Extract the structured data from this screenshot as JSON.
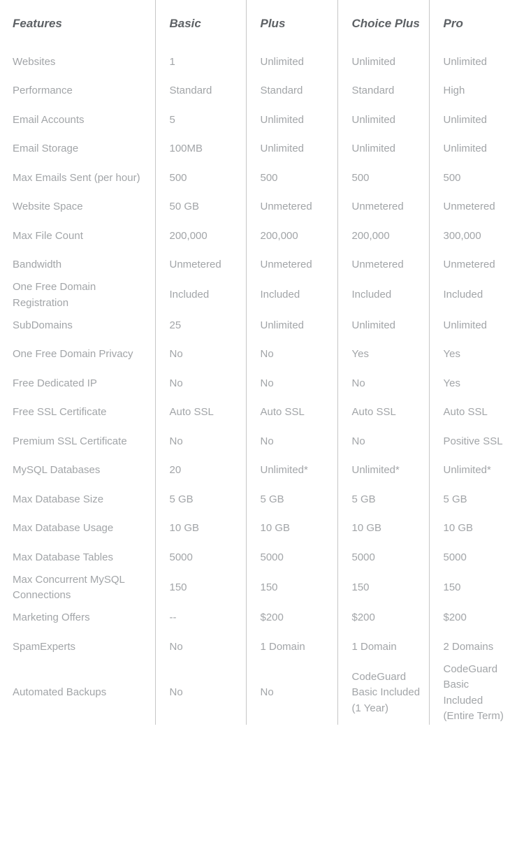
{
  "table": {
    "headers": [
      {
        "label": "Features",
        "key": "features"
      },
      {
        "label": "Basic",
        "key": "basic"
      },
      {
        "label": "Plus",
        "key": "plus"
      },
      {
        "label": "Choice Plus",
        "key": "choice_plus"
      },
      {
        "label": "Pro",
        "key": "pro"
      }
    ],
    "rows": [
      {
        "feature": "Websites",
        "basic": "1",
        "plus": "Unlimited",
        "choice_plus": "Unlimited",
        "pro": "Unlimited"
      },
      {
        "feature": "Performance",
        "basic": "Standard",
        "plus": "Standard",
        "choice_plus": "Standard",
        "pro": "High"
      },
      {
        "feature": "Email Accounts",
        "basic": "5",
        "plus": "Unlimited",
        "choice_plus": "Unlimited",
        "pro": "Unlimited"
      },
      {
        "feature": "Email Storage",
        "basic": "100MB",
        "plus": "Unlimited",
        "choice_plus": "Unlimited",
        "pro": "Unlimited"
      },
      {
        "feature": "Max Emails Sent (per hour)",
        "basic": "500",
        "plus": "500",
        "choice_plus": "500",
        "pro": "500"
      },
      {
        "feature": "Website Space",
        "basic": "50 GB",
        "plus": "Unmetered",
        "choice_plus": "Unmetered",
        "pro": "Unmetered"
      },
      {
        "feature": "Max File Count",
        "basic": "200,000",
        "plus": "200,000",
        "choice_plus": "200,000",
        "pro": "300,000"
      },
      {
        "feature": "Bandwidth",
        "basic": "Unmetered",
        "plus": "Unmetered",
        "choice_plus": "Unmetered",
        "pro": "Unmetered"
      },
      {
        "feature": "One Free Domain Registration",
        "basic": "Included",
        "plus": "Included",
        "choice_plus": "Included",
        "pro": "Included"
      },
      {
        "feature": "SubDomains",
        "basic": "25",
        "plus": "Unlimited",
        "choice_plus": "Unlimited",
        "pro": "Unlimited"
      },
      {
        "feature": "One Free Domain Privacy",
        "basic": "No",
        "plus": "No",
        "choice_plus": "Yes",
        "pro": "Yes"
      },
      {
        "feature": "Free Dedicated IP",
        "basic": "No",
        "plus": "No",
        "choice_plus": "No",
        "pro": "Yes"
      },
      {
        "feature": "Free SSL Certificate",
        "basic": "Auto SSL",
        "plus": "Auto SSL",
        "choice_plus": "Auto SSL",
        "pro": "Auto SSL"
      },
      {
        "feature": "Premium SSL Certificate",
        "basic": "No",
        "plus": "No",
        "choice_plus": "No",
        "pro": "Positive SSL"
      },
      {
        "feature": "MySQL Databases",
        "basic": "20",
        "plus": "Unlimited*",
        "choice_plus": "Unlimited*",
        "pro": "Unlimited*"
      },
      {
        "feature": "Max Database Size",
        "basic": "5 GB",
        "plus": "5 GB",
        "choice_plus": "5 GB",
        "pro": "5 GB"
      },
      {
        "feature": "Max Database Usage",
        "basic": "10 GB",
        "plus": "10 GB",
        "choice_plus": "10 GB",
        "pro": "10 GB"
      },
      {
        "feature": "Max Database Tables",
        "basic": "5000",
        "plus": "5000",
        "choice_plus": "5000",
        "pro": "5000"
      },
      {
        "feature": "Max Concurrent MySQL Connections",
        "basic": "150",
        "plus": "150",
        "choice_plus": "150",
        "pro": "150"
      },
      {
        "feature": "Marketing Offers",
        "basic": "--",
        "plus": "$200",
        "choice_plus": "$200",
        "pro": "$200"
      },
      {
        "feature": "SpamExperts",
        "basic": "No",
        "plus": "1 Domain",
        "choice_plus": "1 Domain",
        "pro": "2 Domains"
      },
      {
        "feature": "Automated Backups",
        "basic": "No",
        "plus": "No",
        "choice_plus": "CodeGuard Basic Included (1 Year)",
        "pro": "CodeGuard Basic Included (Entire Term)"
      }
    ]
  },
  "colors": {
    "header_text": "#5d6165",
    "body_text": "#a2a5a8",
    "divider": "#c7c7c7",
    "background": "#ffffff"
  }
}
